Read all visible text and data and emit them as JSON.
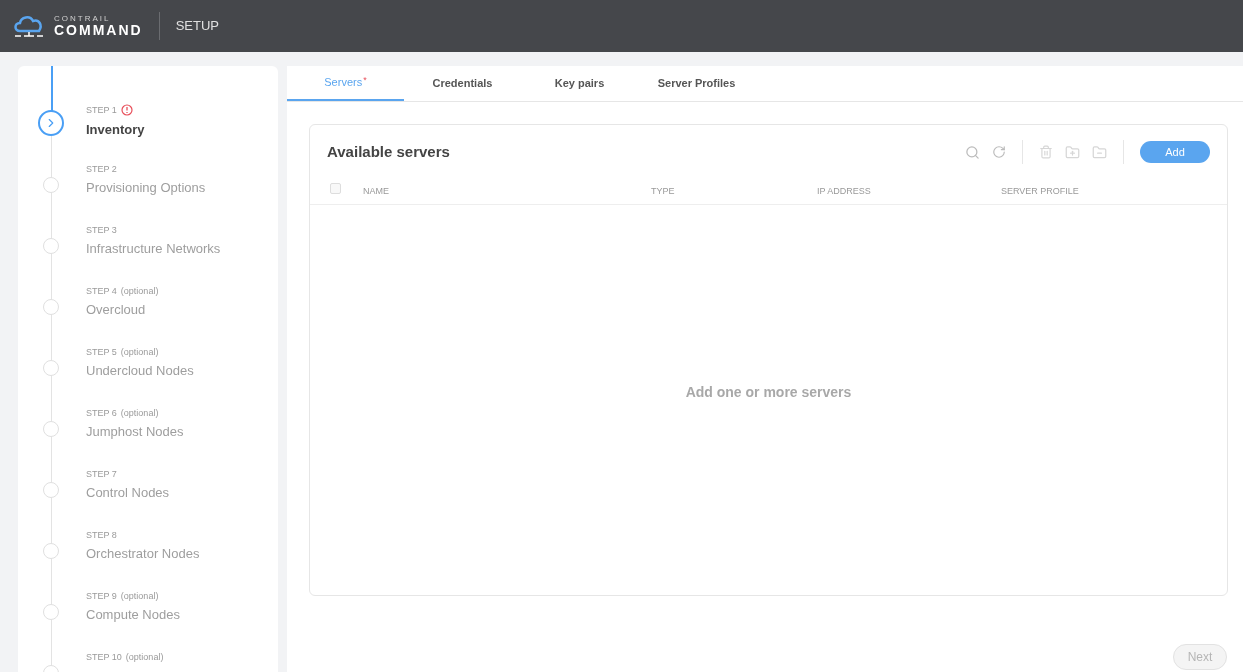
{
  "header": {
    "logo_top": "CONTRAIL",
    "logo_bottom": "COMMAND",
    "section": "SETUP"
  },
  "steps": [
    {
      "label": "STEP 1",
      "title": "Inventory",
      "current": true,
      "error": true
    },
    {
      "label": "STEP 2",
      "title": "Provisioning Options",
      "current": false,
      "error": false
    },
    {
      "label": "STEP 3",
      "title": "Infrastructure Networks",
      "current": false,
      "error": false
    },
    {
      "label": "STEP 4",
      "optional": "(optional)",
      "title": "Overcloud",
      "current": false,
      "error": false
    },
    {
      "label": "STEP 5",
      "optional": "(optional)",
      "title": "Undercloud Nodes",
      "current": false,
      "error": false
    },
    {
      "label": "STEP 6",
      "optional": "(optional)",
      "title": "Jumphost Nodes",
      "current": false,
      "error": false
    },
    {
      "label": "STEP 7",
      "title": "Control Nodes",
      "current": false,
      "error": false
    },
    {
      "label": "STEP 8",
      "title": "Orchestrator Nodes",
      "current": false,
      "error": false
    },
    {
      "label": "STEP 9",
      "optional": "(optional)",
      "title": "Compute Nodes",
      "current": false,
      "error": false
    },
    {
      "label": "STEP 10",
      "optional": "(optional)",
      "current": false,
      "error": false
    }
  ],
  "tabs": [
    {
      "label": "Servers",
      "badge": "*",
      "selected": true
    },
    {
      "label": "Credentials",
      "selected": false
    },
    {
      "label": "Key pairs",
      "selected": false
    },
    {
      "label": "Server Profiles",
      "selected": false
    }
  ],
  "card": {
    "title": "Available servers",
    "add_button": "Add",
    "table": {
      "select_all_checked": false,
      "columns": [
        "NAME",
        "TYPE",
        "IP ADDRESS",
        "SERVER PROFILE"
      ]
    },
    "empty_message": "Add one or more servers"
  },
  "next_button": {
    "label": "Next",
    "disabled": true
  }
}
